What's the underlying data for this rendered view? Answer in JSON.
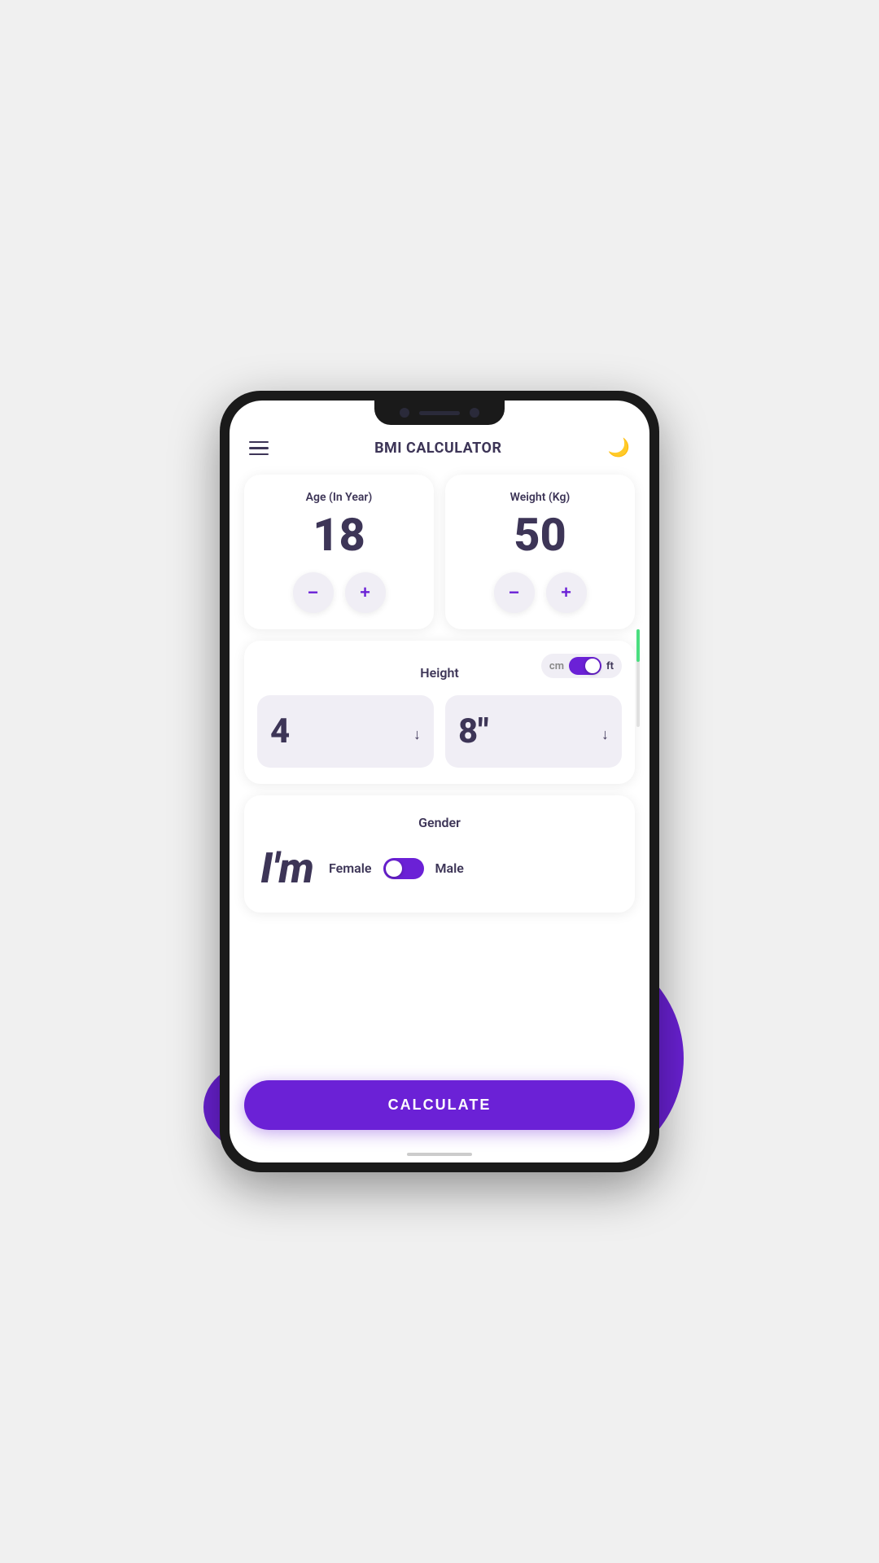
{
  "header": {
    "title": "BMI CALCULATOR",
    "menu_label": "menu",
    "theme_icon": "🌙"
  },
  "age_card": {
    "label": "Age (In Year)",
    "value": "18",
    "decrement_label": "−",
    "increment_label": "+"
  },
  "weight_card": {
    "label": "Weight (Kg)",
    "value": "50",
    "decrement_label": "−",
    "increment_label": "+"
  },
  "height_card": {
    "title": "Height",
    "toggle_cm": "cm",
    "toggle_ft": "ft",
    "feet_value": "4",
    "inches_value": "8\"",
    "unit_active": "ft"
  },
  "gender_card": {
    "title": "Gender",
    "im_text": "I'm",
    "female_label": "Female",
    "male_label": "Male",
    "selected": "female"
  },
  "calculate_button": {
    "label": "CALCULATE"
  }
}
